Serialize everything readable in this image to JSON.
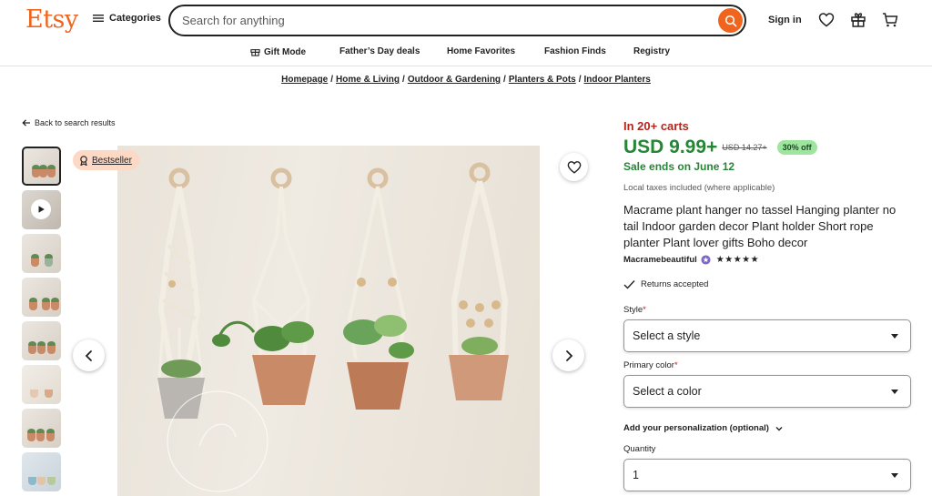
{
  "header": {
    "logo": "Etsy",
    "categories_label": "Categories",
    "search_placeholder": "Search for anything",
    "signin_label": "Sign in"
  },
  "subnav": [
    "Gift Mode",
    "Father’s Day deals",
    "Home Favorites",
    "Fashion Finds",
    "Registry"
  ],
  "breadcrumb": [
    "Homepage",
    "Home & Living",
    "Outdoor & Gardening",
    "Planters & Pots",
    "Indoor Planters"
  ],
  "back_label": "Back to search results",
  "badge": {
    "label": "Bestseller"
  },
  "product": {
    "carts": "In 20+ carts",
    "price": "USD 9.99+",
    "original_price": "USD 14.27+",
    "discount": "30% off",
    "sale_ends": "Sale ends on June 12",
    "tax_note": "Local taxes included (where applicable)",
    "title": "Macrame plant hanger no tassel Hanging planter no tail Indoor garden decor Plant holder Short rope planter Plant lover gifts Boho decor",
    "shop_name": "Macramebeautiful",
    "rating": 5,
    "stars": "★★★★★",
    "returns": "Returns accepted"
  },
  "form": {
    "style_label": "Style",
    "style_value": "Select a style",
    "color_label": "Primary color",
    "color_value": "Select a color",
    "personalization_label": "Add your personalization (optional)",
    "quantity_label": "Quantity",
    "quantity_value": "1",
    "required_mark": "*"
  },
  "colors": {
    "brand": "#f1641e",
    "price_green": "#258635",
    "carts_red": "#b3261e",
    "discount_badge": "#9ee59f",
    "bestseller_badge": "#fdd8c4"
  },
  "icons": [
    "hamburger-icon",
    "search-icon",
    "heart-icon",
    "gift-icon",
    "cart-icon",
    "gift-mode-icon",
    "arrow-left-icon",
    "play-icon",
    "chevron-left-icon",
    "chevron-right-icon",
    "check-icon",
    "star-seller-icon",
    "chevron-down-icon"
  ]
}
